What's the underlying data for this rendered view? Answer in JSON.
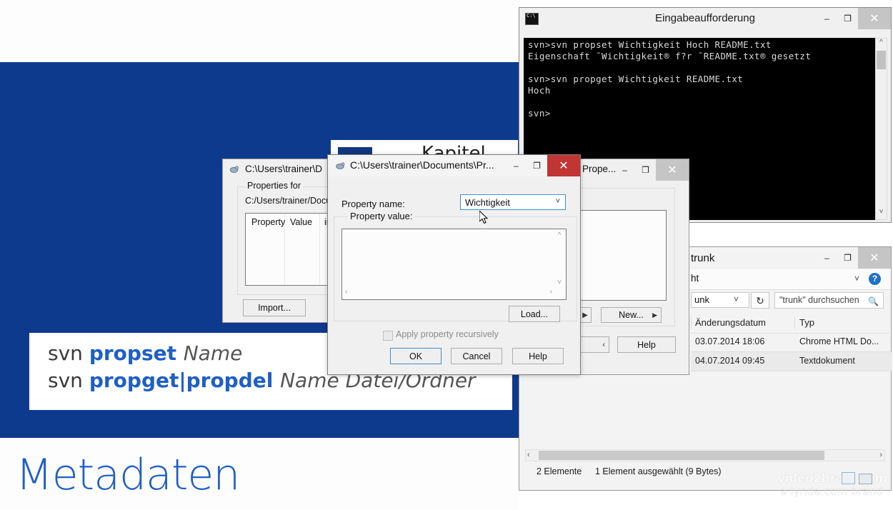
{
  "slide": {
    "title": "Metadaten",
    "paper_text": "Kapitel",
    "code_lines": [
      {
        "prefix": "svn ",
        "keyword": "propset ",
        "italic": "Name"
      },
      {
        "prefix": "svn ",
        "keyword": "propget|propdel ",
        "italic": "Name Datei/Ordner"
      }
    ]
  },
  "cmd": {
    "title": "Eingabeaufforderung",
    "icon": "console-icon",
    "content": "svn>svn propset Wichtigkeit Hoch README.txt\nEigenschaft ¯Wichtigkeit® f?r ¯README.txt® gesetzt\n\nsvn>svn propget Wichtigkeit README.txt\nHoch\n\nsvn>",
    "controls": {
      "minimize": "–",
      "maximize": "❐",
      "close": "✕"
    }
  },
  "explorer": {
    "title": "trunk",
    "ribbon_tab": "ht",
    "address": "unk",
    "refresh_icon": "refresh-icon",
    "search_placeholder": "\"trunk\" durchsuchen",
    "help_label": "?",
    "columns": [
      "Änderungsdatum",
      "Typ"
    ],
    "rows": [
      {
        "date": "03.07.2014 18:06",
        "type": "Chrome HTML Do...",
        "selected": false
      },
      {
        "date": "04.07.2014 09:45",
        "type": "Textdokument",
        "selected": true
      }
    ],
    "status_count": "2 Elemente",
    "status_selection": "1 Element ausgewählt (9 Bytes)",
    "controls": {
      "minimize": "–",
      "maximize": "❐",
      "close": "✕"
    }
  },
  "props_back": {
    "title": "C:\\Users\\trainer\\D",
    "group_label": "Properties for",
    "path": "C:/Users/trainer/Docume",
    "columns": [
      "Property",
      "Value",
      "inhe"
    ],
    "import_label": "Import..."
  },
  "props_right": {
    "title": "Prope...",
    "new_label": "New...",
    "new_arrow": "▶",
    "left_arrow": "▶",
    "back_arrow": "‹",
    "help_label": "Help",
    "controls": {
      "minimize": "–",
      "maximize": "❐",
      "close": "✕"
    }
  },
  "prop_dialog": {
    "title": "C:\\Users\\trainer\\Documents\\Pr...",
    "name_label": "Property name:",
    "name_value": "Wichtigkeit",
    "value_label": "Property value:",
    "value_text": "",
    "load_label": "Load...",
    "recursive_label": "Apply property recursively",
    "ok_label": "OK",
    "cancel_label": "Cancel",
    "help_label": "Help",
    "controls": {
      "minimize": "–",
      "maximize": "❐",
      "close": "✕"
    }
  },
  "watermark": {
    "line1": "video2brain.com",
    "line2": "a lynda.com brand"
  }
}
